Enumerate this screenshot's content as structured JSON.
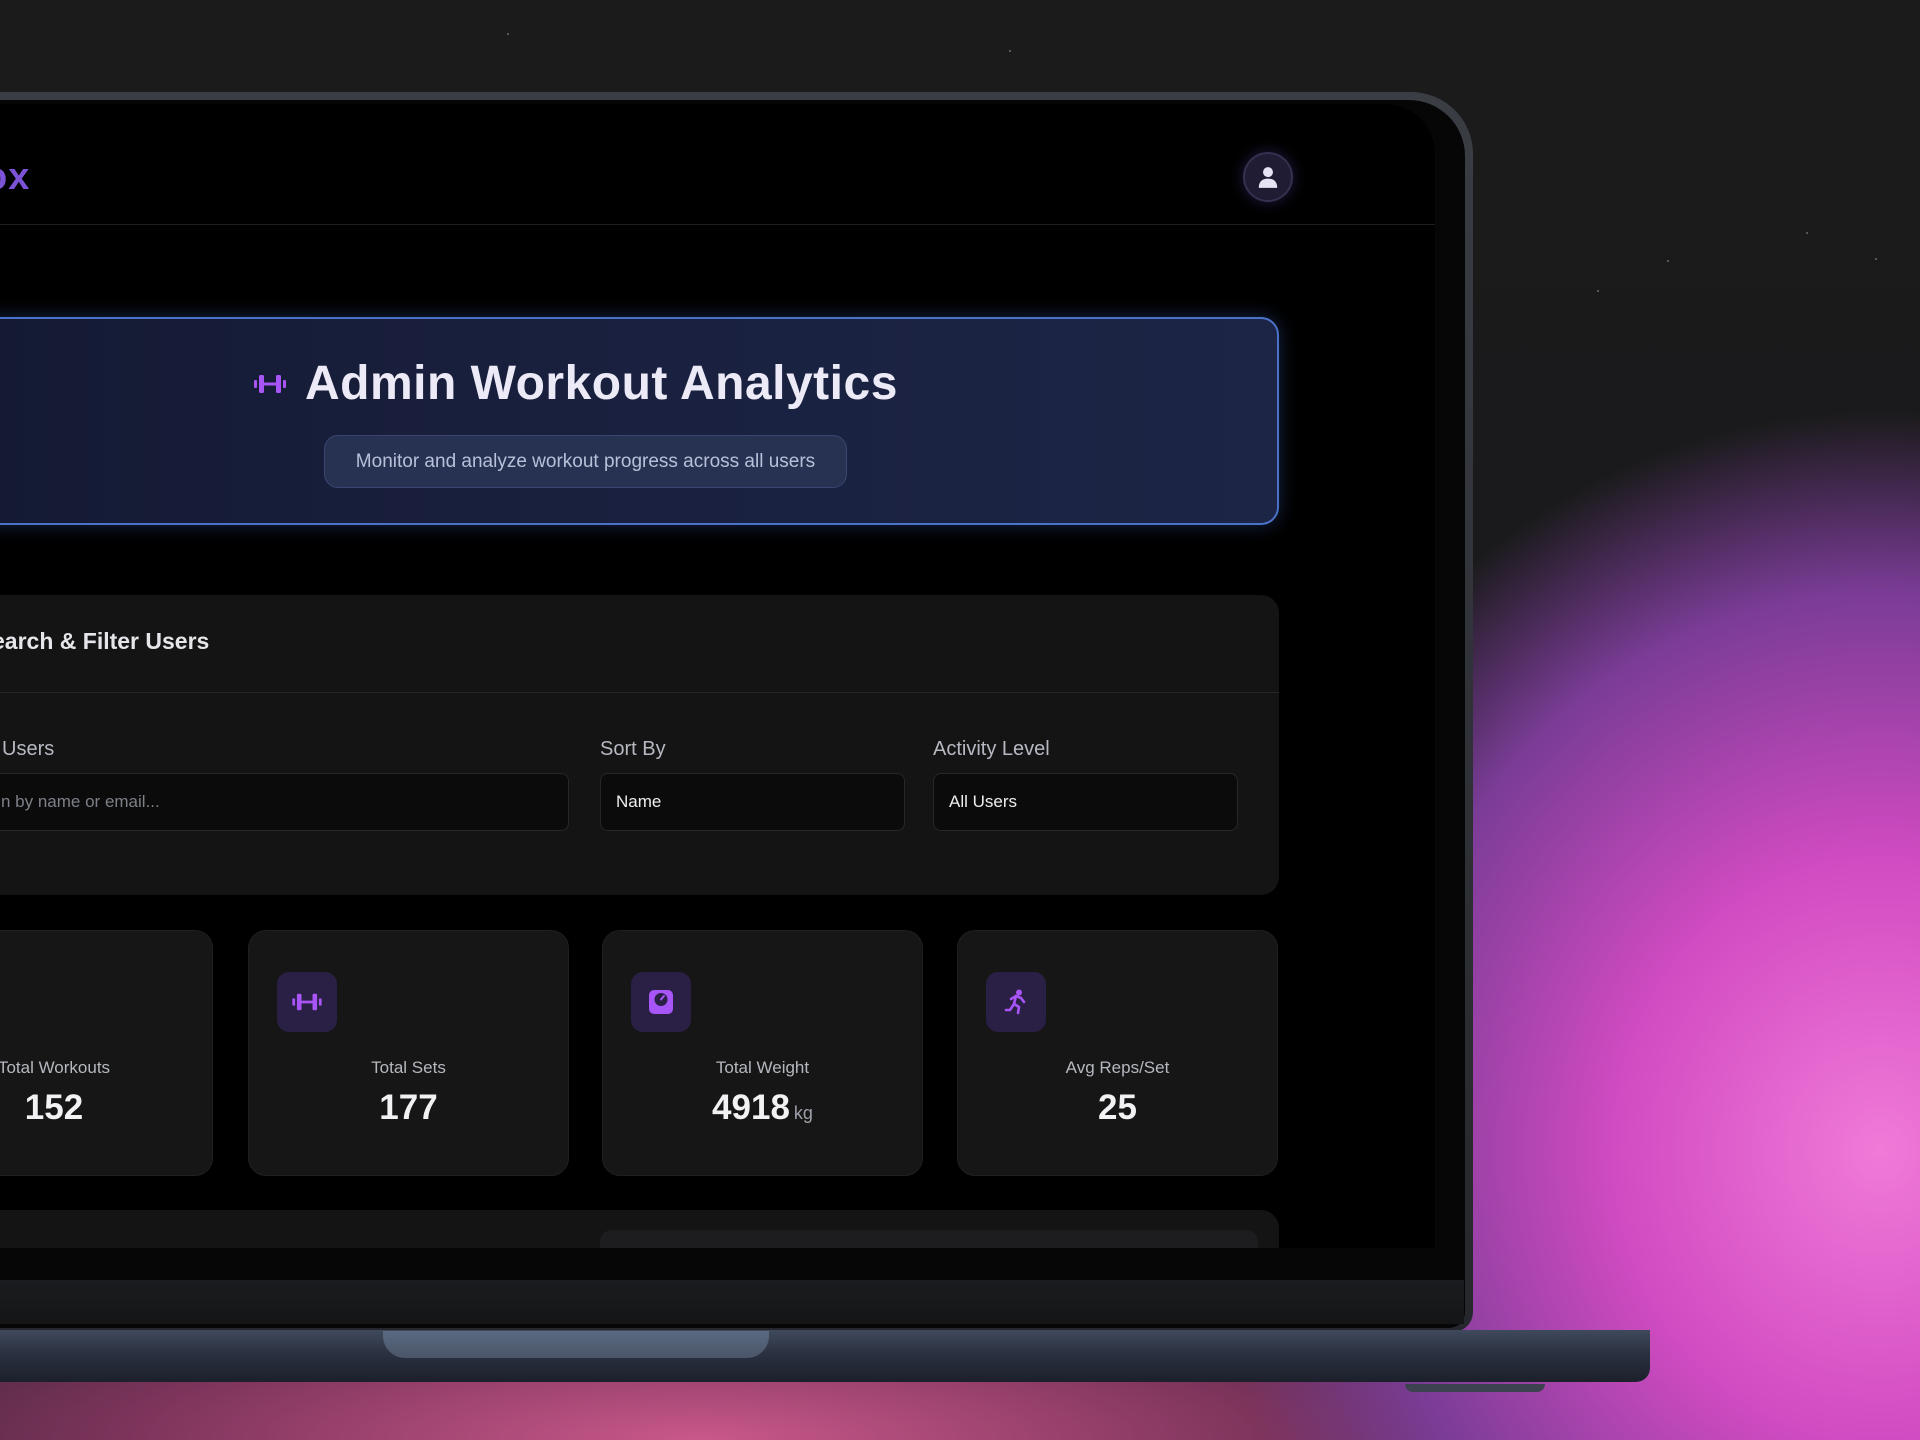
{
  "app": {
    "logo_text": "ox",
    "avatar_icon": "user-icon"
  },
  "hero": {
    "icon": "dumbbell-icon",
    "title": "Admin Workout Analytics",
    "subtitle": "Monitor and analyze workout progress across all users"
  },
  "filters": {
    "title": "earch & Filter Users",
    "search": {
      "label": "Users",
      "placeholder": "n by name or email..."
    },
    "sort": {
      "label": "Sort By",
      "value": "Name"
    },
    "activity": {
      "label": "Activity Level",
      "value": "All Users"
    }
  },
  "stats": [
    {
      "label": "Total Workouts",
      "value": "152",
      "unit": "",
      "icon": ""
    },
    {
      "label": "Total Sets",
      "value": "177",
      "unit": "",
      "icon": "dumbbell-icon"
    },
    {
      "label": "Total Weight",
      "value": "4918",
      "unit": "kg",
      "icon": "scale-icon"
    },
    {
      "label": "Avg Reps/Set",
      "value": "25",
      "unit": "",
      "icon": "running-icon"
    }
  ],
  "colors": {
    "accent": "#7c52d6",
    "icon_purple": "#a855f7",
    "hero_border": "#4a72c8",
    "screen_bg": "#000000",
    "card_bg": "#161616"
  }
}
